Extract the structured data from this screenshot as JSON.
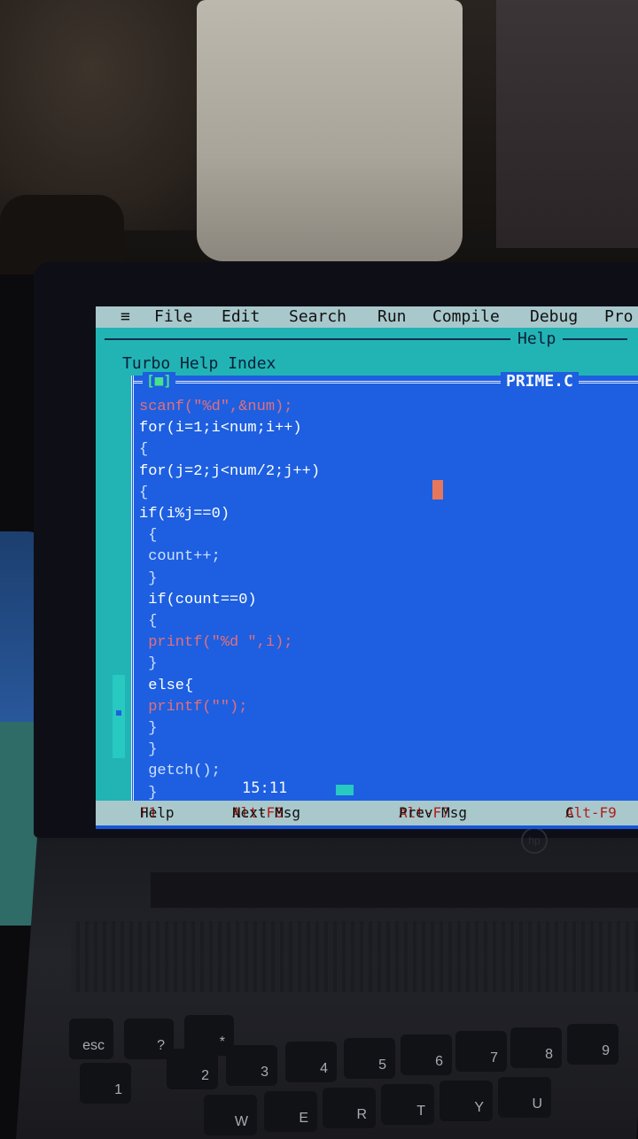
{
  "ide": {
    "menu": {
      "system_icon": "≡",
      "items": [
        "File",
        "Edit",
        "Search",
        "Run",
        "Compile",
        "Debug",
        "Pro"
      ]
    },
    "help_bar_title": "Help",
    "help_window_title": "Turbo Help Index",
    "editor": {
      "close_box": "[■]",
      "filename": "PRIME.C",
      "cursor_position": "15:11",
      "code_lines": [
        "scanf(\"%d\",&num);",
        "for(i=1;i<num;i++)",
        "{",
        "for(j=2;j<num/2;j++)",
        "{",
        "if(i%j==0)",
        "{",
        "count++;",
        "}",
        "if(count==0)",
        "{",
        "printf(\"%d \",i);",
        "}",
        "else{",
        "printf(\"\");",
        "}",
        "}",
        "getch();",
        "}"
      ]
    },
    "status": [
      {
        "key": "F1",
        "label": "Help"
      },
      {
        "key": "Alt-F8",
        "label": "Next Msg"
      },
      {
        "key": "Alt-F7",
        "label": "Prev Msg"
      },
      {
        "key": "Alt-F9",
        "label": "C"
      }
    ]
  },
  "keyboard": {
    "keys": [
      "esc",
      "?",
      "*",
      "2",
      "3",
      "4",
      "5",
      "6",
      "7",
      "8",
      "9",
      "1",
      "W",
      "E",
      "R",
      "T",
      "Y",
      "U"
    ]
  },
  "colors": {
    "screen_blue": "#1d5fe0",
    "help_cyan": "#22b4b4",
    "menu_gray": "#a8c8cc",
    "hotkey_red": "#b1201a",
    "cursor": "#e6765e"
  }
}
